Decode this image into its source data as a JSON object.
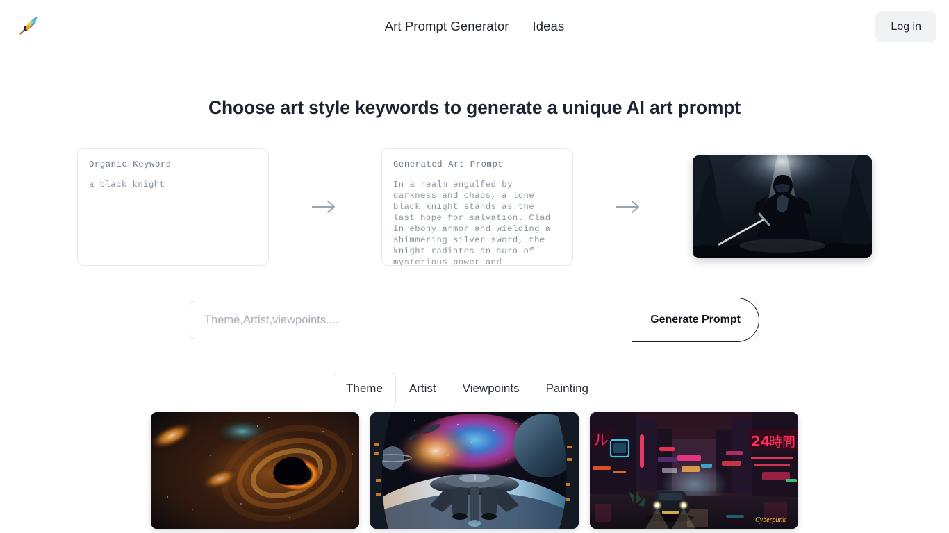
{
  "header": {
    "logo_icon": "paintbrush-icon",
    "nav": [
      {
        "label": "Art Prompt Generator"
      },
      {
        "label": "Ideas"
      }
    ],
    "login_label": "Log in"
  },
  "headline": "Choose art style keywords to generate a unique AI art prompt",
  "flow": {
    "keyword_card": {
      "title": "Organic Keyword",
      "body": "a black knight"
    },
    "arrow_glyph": "→",
    "prompt_card": {
      "title": "Generated Art Prompt",
      "body": "In a realm engulfed by darkness and chaos, a lone black knight stands as the last hope for salvation. Clad in ebony armor and wielding a shimmering silver sword, the knight radiates an aura of mysterious power and unwavering determination."
    },
    "result_image": {
      "alt": "black-knight-artwork"
    }
  },
  "search": {
    "placeholder": "Theme,Artist,viewpoints....",
    "value": "",
    "button_label": "Generate Prompt"
  },
  "tabs": [
    {
      "label": "Theme",
      "active": true
    },
    {
      "label": "Artist",
      "active": false
    },
    {
      "label": "Viewpoints",
      "active": false
    },
    {
      "label": "Painting",
      "active": false
    }
  ],
  "gallery": [
    {
      "alt": "black-hole-galaxy-artwork"
    },
    {
      "alt": "spaceship-nebula-artwork"
    },
    {
      "alt": "cyberpunk-neon-street-artwork"
    }
  ],
  "colors": {
    "page_background": "#ffffff",
    "text_primary": "#1f2430",
    "text_muted": "#8a93a3",
    "border": "#e7e8ea",
    "login_background": "#f1f2f4",
    "button_border": "#161a22",
    "arrow": "#9aa3b2"
  }
}
